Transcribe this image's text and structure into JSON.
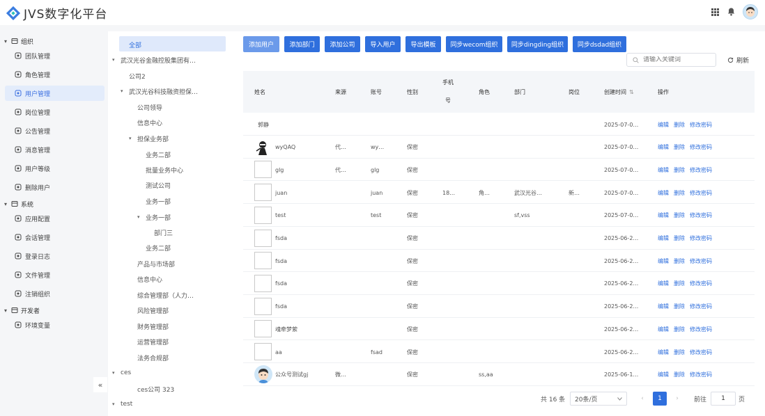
{
  "app": {
    "title": "JVS数字化平台"
  },
  "sidebar": {
    "groups": [
      {
        "label": "组织",
        "items": [
          "团队管理",
          "角色管理",
          "用户管理",
          "岗位管理",
          "公告管理",
          "消息管理",
          "用户等级",
          "删除用户"
        ]
      },
      {
        "label": "系统",
        "items": [
          "应用配置",
          "会话管理",
          "登录日志",
          "文件管理",
          "注销组织"
        ]
      },
      {
        "label": "开发者",
        "items": [
          "环境变量"
        ]
      }
    ],
    "active": "用户管理",
    "collapse_label": "«"
  },
  "tree": {
    "nodes": [
      {
        "label": "全部",
        "level": 0,
        "arrow": "",
        "selected": true
      },
      {
        "label": "武汉光谷金融控股集团有…",
        "level": 0,
        "arrow": "▾"
      },
      {
        "label": "公司2",
        "level": 1,
        "arrow": ""
      },
      {
        "label": "武汉光谷科技融资担保…",
        "level": 1,
        "arrow": "▾"
      },
      {
        "label": "公司领导",
        "level": 2,
        "arrow": ""
      },
      {
        "label": "信息中心",
        "level": 2,
        "arrow": ""
      },
      {
        "label": "担保业务部",
        "level": 2,
        "arrow": "▾"
      },
      {
        "label": "业务二部",
        "level": 3,
        "arrow": ""
      },
      {
        "label": "批量业务中心",
        "level": 3,
        "arrow": ""
      },
      {
        "label": "测试公司",
        "level": 3,
        "arrow": ""
      },
      {
        "label": "业务一部",
        "level": 3,
        "arrow": ""
      },
      {
        "label": "业务一部",
        "level": 3,
        "arrow": "▾"
      },
      {
        "label": "部门三",
        "level": 4,
        "arrow": ""
      },
      {
        "label": "业务二部",
        "level": 3,
        "arrow": ""
      },
      {
        "label": "产品与市场部",
        "level": 2,
        "arrow": ""
      },
      {
        "label": "信息中心",
        "level": 2,
        "arrow": ""
      },
      {
        "label": "综合管理部（人力…",
        "level": 2,
        "arrow": ""
      },
      {
        "label": "风险管理部",
        "level": 2,
        "arrow": ""
      },
      {
        "label": "财务管理部",
        "level": 2,
        "arrow": ""
      },
      {
        "label": "运营管理部",
        "level": 2,
        "arrow": ""
      },
      {
        "label": "法务合规部",
        "level": 2,
        "arrow": ""
      },
      {
        "label": "ces",
        "level": 0,
        "arrow": "▾"
      },
      {
        "label": "ces公司 323",
        "level": 2,
        "arrow": ""
      },
      {
        "label": "test",
        "level": 0,
        "arrow": "▾"
      }
    ]
  },
  "toolbar": {
    "buttons": [
      "添加用户",
      "添加部门",
      "添加公司",
      "导入用户",
      "导出模板",
      "同步wecom组织",
      "同步dingding组织",
      "同步dsdad组织"
    ],
    "search_placeholder": "请输入关键词",
    "refresh_label": "刷新"
  },
  "table": {
    "headers": [
      "姓名",
      "来源",
      "账号",
      "性别",
      "手机号",
      "角色",
      "部门",
      "岗位",
      "创建时间",
      "操作"
    ],
    "phone_header_lines": [
      "手机",
      "号"
    ],
    "sort_glyph": "⇅",
    "ops": [
      "编辑",
      "删除",
      "修改密码"
    ],
    "rows": [
      {
        "avatar": "none",
        "name": "郭静",
        "source": "",
        "account": "",
        "gender": "",
        "phone": "",
        "role": "",
        "dept": "",
        "post": "",
        "created": "2025-07-0…"
      },
      {
        "avatar": "ninja",
        "name": "wyQAQ",
        "source": "代…",
        "account": "wy…",
        "gender": "保密",
        "phone": "",
        "role": "",
        "dept": "",
        "post": "",
        "created": "2025-07-0…"
      },
      {
        "avatar": "broken",
        "name": "glg",
        "source": "代…",
        "account": "glg",
        "gender": "保密",
        "phone": "",
        "role": "",
        "dept": "",
        "post": "",
        "created": "2025-07-0…"
      },
      {
        "avatar": "broken",
        "name": "juan",
        "source": "",
        "account": "juan",
        "gender": "保密",
        "phone": "18…",
        "role": "角…",
        "dept": "武汉光谷…",
        "post": "新…",
        "created": "2025-07-0…"
      },
      {
        "avatar": "broken",
        "name": "test",
        "source": "",
        "account": "test",
        "gender": "保密",
        "phone": "",
        "role": "",
        "dept": "sf,vss",
        "post": "",
        "created": "2025-07-0…"
      },
      {
        "avatar": "broken",
        "name": "fsda",
        "source": "",
        "account": "",
        "gender": "保密",
        "phone": "",
        "role": "",
        "dept": "",
        "post": "",
        "created": "2025-06-2…"
      },
      {
        "avatar": "broken",
        "name": "fsda",
        "source": "",
        "account": "",
        "gender": "保密",
        "phone": "",
        "role": "",
        "dept": "",
        "post": "",
        "created": "2025-06-2…"
      },
      {
        "avatar": "broken",
        "name": "fsda",
        "source": "",
        "account": "",
        "gender": "保密",
        "phone": "",
        "role": "",
        "dept": "",
        "post": "",
        "created": "2025-06-2…"
      },
      {
        "avatar": "broken",
        "name": "fsda",
        "source": "",
        "account": "",
        "gender": "保密",
        "phone": "",
        "role": "",
        "dept": "",
        "post": "",
        "created": "2025-06-2…"
      },
      {
        "avatar": "broken",
        "name": "魂牵梦萦",
        "source": "",
        "account": "",
        "gender": "保密",
        "phone": "",
        "role": "",
        "dept": "",
        "post": "",
        "created": "2025-06-2…"
      },
      {
        "avatar": "broken",
        "name": "aa",
        "source": "",
        "account": "fsad",
        "gender": "保密",
        "phone": "",
        "role": "",
        "dept": "",
        "post": "",
        "created": "2025-06-2…"
      },
      {
        "avatar": "boy",
        "name": "公众号测试gj",
        "source": "微…",
        "account": "",
        "gender": "保密",
        "phone": "",
        "role": "ss,aa",
        "dept": "",
        "post": "",
        "created": "2025-06-1…"
      }
    ]
  },
  "pagination": {
    "total": "共 16 条",
    "page_size": "20条/页",
    "prev": "‹",
    "current_page": "1",
    "next": "›",
    "goto_label": "前往",
    "goto_value": "1",
    "page_unit": "页"
  },
  "colors": {
    "primary": "#2f6fdd",
    "primary_light": "#6b9aea",
    "selected_bg": "#dfe9fb"
  }
}
